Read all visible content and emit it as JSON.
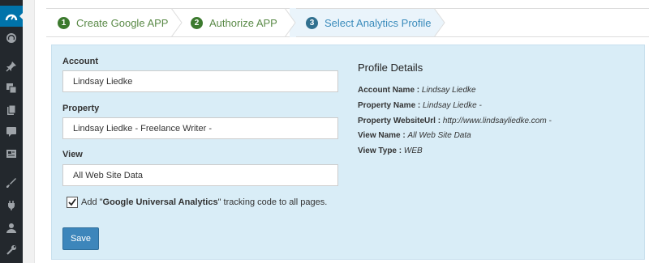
{
  "steps": [
    {
      "number": "1",
      "label": "Create Google APP"
    },
    {
      "number": "2",
      "label": "Authorize APP"
    },
    {
      "number": "3",
      "label": "Select Analytics Profile"
    }
  ],
  "form": {
    "account_label": "Account",
    "account_value": "Lindsay Liedke",
    "property_label": "Property",
    "property_value": "Lindsay Liedke - Freelance Writer -",
    "view_label": "View",
    "view_value": "All Web Site Data",
    "tracking_prefix": "Add \"",
    "tracking_bold": "Google Universal Analytics",
    "tracking_suffix": "\" tracking code to all pages.",
    "tracking_checked": true,
    "save_label": "Save"
  },
  "details": {
    "title": "Profile Details",
    "rows": [
      {
        "key": "Account Name :",
        "value": "Lindsay Liedke"
      },
      {
        "key": "Property Name :",
        "value": "Lindsay Liedke -"
      },
      {
        "key": "Property WebsiteUrl :",
        "value": "http://www.lindsayliedke.com -"
      },
      {
        "key": "View Name :",
        "value": "All Web Site Data"
      },
      {
        "key": "View Type :",
        "value": "WEB"
      }
    ]
  },
  "sidebar_icons": [
    "dashboard-icon",
    "gauge-icon",
    "pin-icon",
    "media-icon",
    "pages-icon",
    "comments-icon",
    "forms-icon",
    "appearance-icon",
    "plugins-icon",
    "users-icon",
    "tools-icon"
  ],
  "colors": {
    "sidebar": "#23282d",
    "active": "#0073aa",
    "panel": "#d9edf7",
    "step_done": "#3c7a2e",
    "step_active": "#31708f",
    "button": "#3d86bb"
  }
}
